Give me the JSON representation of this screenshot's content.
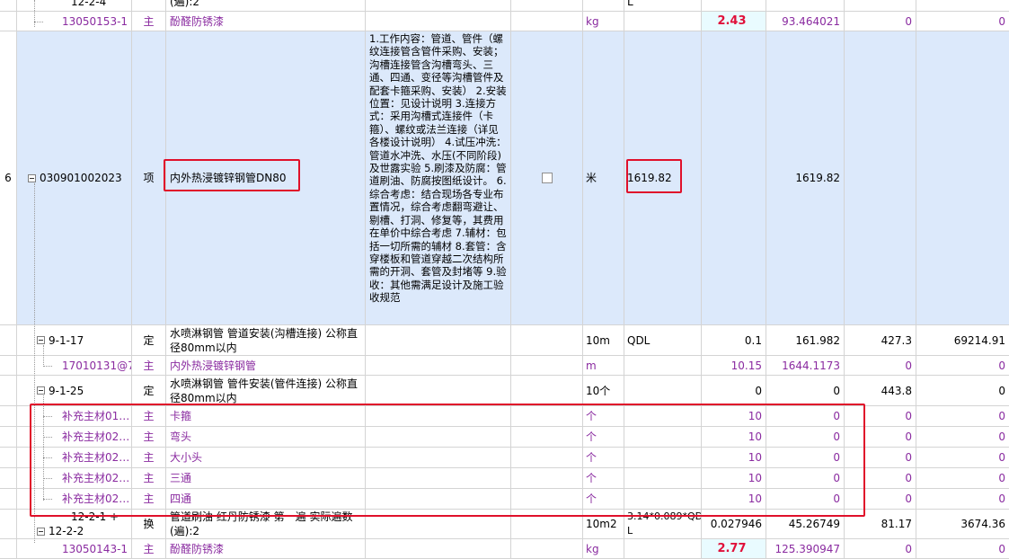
{
  "rows": {
    "r_top": {
      "code": "12-2-4",
      "name": "(遍):2",
      "unit_expr": "L"
    },
    "r1": {
      "code": "13050153-1",
      "type": "主",
      "name": "酚醛防锈漆",
      "unit": "kg",
      "qty": "2.43",
      "price": "93.464021",
      "v1": "0",
      "v2": "0"
    },
    "r6": {
      "num": "6",
      "code": "030901002023",
      "type": "项",
      "name": "内外热浸镀锌钢管DN80",
      "desc": "1.工作内容：管道、管件（螺纹连接管含管件采购、安装；沟槽连接管含沟槽弯头、三通、四通、变径等沟槽管件及配套卡箍采购、安装）\n2.安装位置：见设计说明\n3.连接方式：采用沟槽式连接件（卡箍）、螺纹或法兰连接（详见各楼设计说明）\n4.试压冲洗：管道水冲洗、水压(不同阶段)及世露实验\n5.刷漆及防腐：管道刷油、防腐按图纸设计。\n6.综合考虑：结合现场各专业布置情况，综合考虑翻弯避让、剔槽、打洞、修复等，其费用在单价中综合考虑\n7.辅材：包括一切所需的辅材\n8.套管：含穿楼板和管道穿越二次结构所需的开洞、套管及封堵等\n9.验收：其他需满足设计及施工验收规范",
      "unit": "米",
      "qty_expr": "1619.82",
      "qty": "1619.82"
    },
    "r7": {
      "code": "9-1-17",
      "type": "定",
      "name": "水喷淋钢管 管道安装(沟槽连接) 公称直径80mm以内",
      "unit": "10m",
      "expr": "QDL",
      "qty": "0.1",
      "price": "161.982",
      "v1": "427.3",
      "v2": "69214.91"
    },
    "r8": {
      "code": "17010131@7",
      "type": "主",
      "name": "内外热浸镀锌钢管",
      "unit": "m",
      "qty": "10.15",
      "price": "1644.1173",
      "v1": "0",
      "v2": "0"
    },
    "r9": {
      "code": "9-1-25",
      "type": "定",
      "name": "水喷淋钢管 管件安装(管件连接) 公称直径80mm以内",
      "unit": "10个",
      "qty": "0",
      "price": "0",
      "v1": "443.8",
      "v2": "0"
    },
    "supp": [
      {
        "code": "补充主材01…",
        "type": "主",
        "name": "卡箍",
        "unit": "个",
        "qty": "10",
        "price": "0",
        "v1": "0",
        "v2": "0"
      },
      {
        "code": "补充主材02…",
        "type": "主",
        "name": "弯头",
        "unit": "个",
        "qty": "10",
        "price": "0",
        "v1": "0",
        "v2": "0"
      },
      {
        "code": "补充主材02…",
        "type": "主",
        "name": "大小头",
        "unit": "个",
        "qty": "10",
        "price": "0",
        "v1": "0",
        "v2": "0"
      },
      {
        "code": "补充主材02…",
        "type": "主",
        "name": "三通",
        "unit": "个",
        "qty": "10",
        "price": "0",
        "v1": "0",
        "v2": "0"
      },
      {
        "code": "补充主材02…",
        "type": "主",
        "name": "四通",
        "unit": "个",
        "qty": "10",
        "price": "0",
        "v1": "0",
        "v2": "0"
      }
    ],
    "r15": {
      "code_a": "12-2-1 +",
      "code_b": "12-2-2",
      "type": "换",
      "name": "管道刷油 红丹防锈漆 第一遍  实际遍数(遍):2",
      "unit": "10m2",
      "expr_a": "3.14*0.089*QD",
      "expr_b": "L",
      "qty": "0.027946",
      "price": "45.26749",
      "v1": "81.17",
      "v2": "3674.36"
    },
    "r16": {
      "code": "13050143-1",
      "type": "主",
      "name": "酚醛防锈漆",
      "unit": "kg",
      "qty": "2.77",
      "price": "125.390947",
      "v1": "0",
      "v2": "0"
    }
  }
}
